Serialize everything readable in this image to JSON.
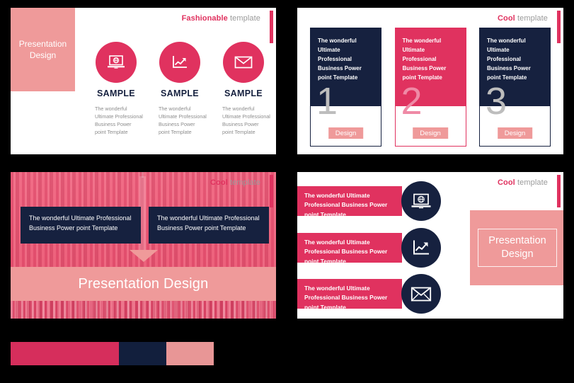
{
  "palette": {
    "pink": "#e0325f",
    "navy": "#16213f",
    "salmon": "#ef9a9a",
    "grey_text": "#8d8d8d",
    "white": "#ffffff"
  },
  "slides": [
    {
      "id": "slide-fashionable-three-icons",
      "header": {
        "strong": "Fashionable",
        "light": "template"
      },
      "panel_title": "Presentation\nDesign",
      "columns": [
        {
          "icon": "laptop-globe-icon",
          "title": "SAMPLE",
          "desc": "The wonderful Ultimate Professional Business Power point Template"
        },
        {
          "icon": "growth-chart-icon",
          "title": "SAMPLE",
          "desc": "The wonderful Ultimate Professional Business Power point Template"
        },
        {
          "icon": "envelope-icon",
          "title": "SAMPLE",
          "desc": "The wonderful Ultimate Professional Business Power point Template"
        }
      ]
    },
    {
      "id": "slide-cool-numbered-cards",
      "header": {
        "strong": "Cool",
        "light": "template"
      },
      "cards": [
        {
          "body": "The wonderful Ultimate Professional Business Power point Template",
          "number": "1",
          "button": "Design",
          "variant": "navy"
        },
        {
          "body": "The wonderful Ultimate Professional Business Power point Template",
          "number": "2",
          "button": "Design",
          "variant": "pink"
        },
        {
          "body": "The wonderful Ultimate Professional Business Power point Template",
          "number": "3",
          "button": "Design",
          "variant": "navy"
        }
      ]
    },
    {
      "id": "slide-cool-cityscape",
      "header": {
        "strong": "Cool",
        "light": "template"
      },
      "boxes": [
        "The wonderful Ultimate Professional Business Power point Template",
        "The wonderful Ultimate Professional Business Power point Template"
      ],
      "banner": "Presentation Design"
    },
    {
      "id": "slide-cool-icon-list",
      "header": {
        "strong": "Cool",
        "light": "template"
      },
      "rows": [
        {
          "text": "The wonderful Ultimate Professional Business Power point Template",
          "icon": "laptop-globe-icon"
        },
        {
          "text": "The wonderful Ultimate Professional Business Power point Template",
          "icon": "growth-chart-icon"
        },
        {
          "text": "The wonderful Ultimate Professional Business Power point Template",
          "icon": "envelope-icon"
        }
      ],
      "panel_title": "Presentation\nDesign"
    }
  ],
  "swatches": [
    {
      "name": "swatch-pink",
      "color": "#d62e5c",
      "width": 153
    },
    {
      "name": "swatch-navy",
      "color": "#121f3d",
      "width": 67
    },
    {
      "name": "swatch-salmon",
      "color": "#e89696",
      "width": 67
    }
  ]
}
